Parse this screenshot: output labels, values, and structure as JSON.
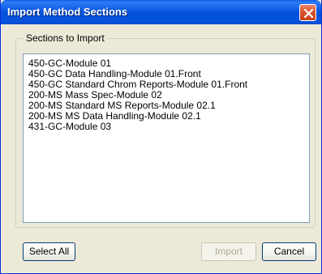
{
  "window": {
    "title": "Import Method Sections"
  },
  "group": {
    "label": "Sections to Import"
  },
  "sections": [
    "450-GC-Module 01",
    "450-GC Data Handling-Module 01.Front",
    "450-GC Standard Chrom Reports-Module 01.Front",
    "200-MS Mass Spec-Module 02",
    "200-MS Standard MS Reports-Module 02.1",
    "200-MS MS Data Handling-Module 02.1",
    "431-GC-Module 03"
  ],
  "buttons": {
    "select_all": "Select All",
    "import": "Import",
    "cancel": "Cancel"
  },
  "colors": {
    "titlebar": "#0453d9",
    "close": "#d9542c",
    "dialog_bg": "#ece9d8"
  },
  "icons": {
    "close": "close-icon"
  }
}
